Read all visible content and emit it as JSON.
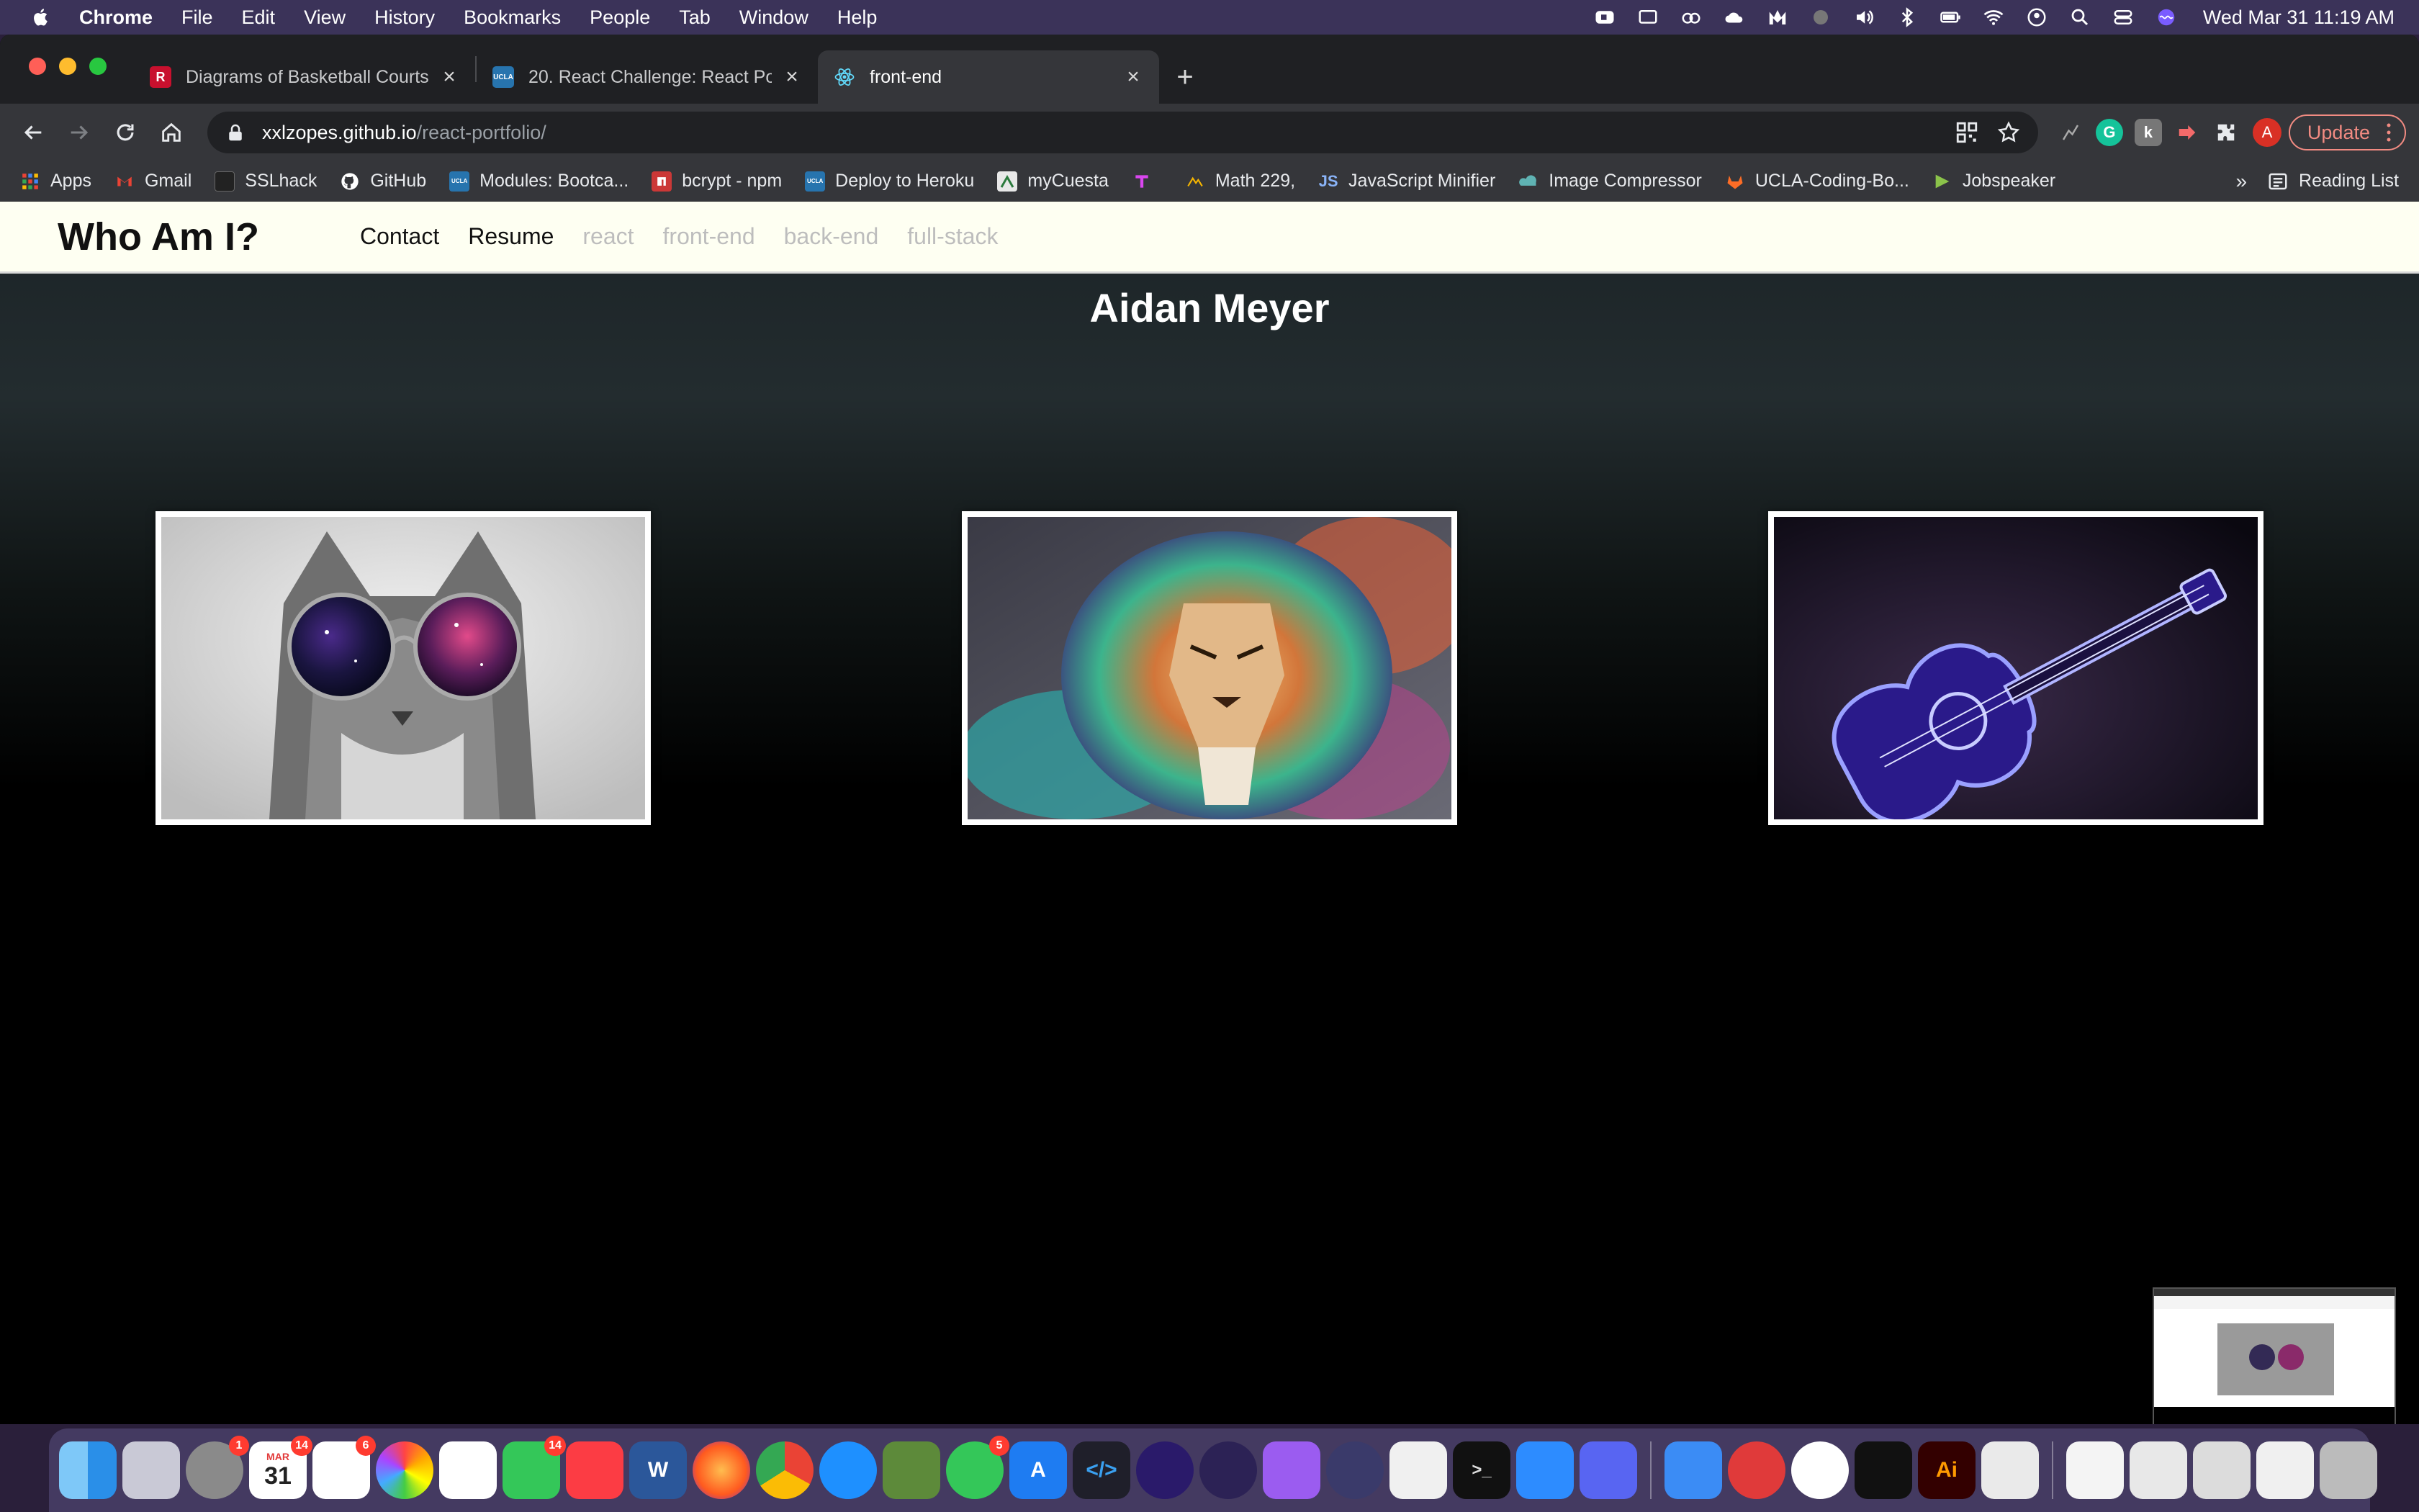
{
  "menubar": {
    "app_name": "Chrome",
    "items": [
      "File",
      "Edit",
      "View",
      "History",
      "Bookmarks",
      "People",
      "Tab",
      "Window",
      "Help"
    ],
    "clock": "Wed Mar 31  11:19 AM"
  },
  "tabs": [
    {
      "title": "Diagrams of Basketball Courts",
      "favicon": "R",
      "favicon_color": "#c8102e"
    },
    {
      "title": "20. React Challenge: React Por",
      "favicon": "UCLA",
      "favicon_color": "#2774ae"
    },
    {
      "title": "front-end",
      "favicon": "react-icon",
      "favicon_color": "#61dafb",
      "active": true
    }
  ],
  "toolbar": {
    "url_host": "xxlzopes.github.io",
    "url_path": "/react-portfolio/",
    "update_label": "Update",
    "avatar_letter": "A"
  },
  "bookmarks": {
    "items": [
      {
        "label": "Apps",
        "icon": "apps-grid-icon"
      },
      {
        "label": "Gmail",
        "icon": "gmail-icon"
      },
      {
        "label": "SSLhack",
        "icon": "sslhack-icon"
      },
      {
        "label": "GitHub",
        "icon": "github-icon"
      },
      {
        "label": "Modules: Bootca...",
        "icon": "ucla-icon"
      },
      {
        "label": "bcrypt - npm",
        "icon": "npm-icon"
      },
      {
        "label": "Deploy to Heroku",
        "icon": "ucla-icon"
      },
      {
        "label": "myCuesta",
        "icon": "cuesta-icon"
      },
      {
        "label": "",
        "icon": "tailwind-icon"
      },
      {
        "label": "Math 229,",
        "icon": "math-icon"
      },
      {
        "label": "JavaScript Minifier",
        "icon": "js-icon"
      },
      {
        "label": "Image Compressor",
        "icon": "image-compressor-icon"
      },
      {
        "label": "UCLA-Coding-Bo...",
        "icon": "gitlab-icon"
      },
      {
        "label": "Jobspeaker",
        "icon": "jobspeaker-icon"
      }
    ],
    "more": "»",
    "reading_list": "Reading List"
  },
  "site": {
    "brand": "Who Am I?",
    "nav": [
      {
        "label": "Contact",
        "enabled": true
      },
      {
        "label": "Resume",
        "enabled": true
      },
      {
        "label": "react",
        "enabled": false
      },
      {
        "label": "front-end",
        "enabled": false
      },
      {
        "label": "back-end",
        "enabled": false
      },
      {
        "label": "full-stack",
        "enabled": false
      }
    ],
    "hero_name": "Aidan Meyer",
    "photos": [
      "cat-with-galaxy-sunglasses",
      "rainbow-lion",
      "neon-guitar"
    ]
  },
  "dock": {
    "badges": {
      "system-preferences": "1",
      "calendar": "14",
      "reminders": "6",
      "facetime": "14",
      "messages": "5"
    },
    "calendar_date": "31",
    "calendar_month": "MAR"
  }
}
